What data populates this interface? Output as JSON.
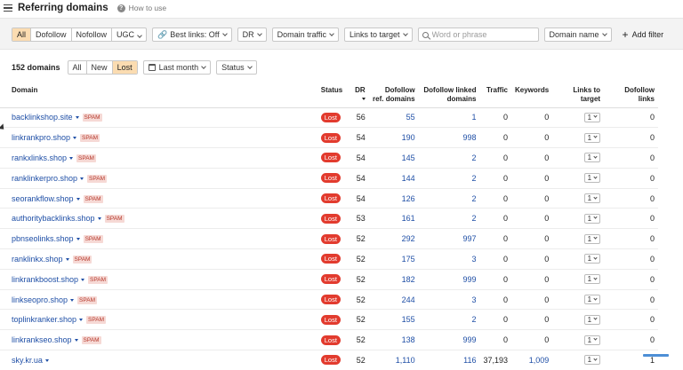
{
  "header": {
    "title": "Referring domains",
    "howto": "How to use"
  },
  "filters": {
    "link_types": [
      "All",
      "Dofollow",
      "Nofollow",
      "UGC"
    ],
    "best_links": "Best links: Off",
    "dr": "DR",
    "domain_traffic": "Domain traffic",
    "links_to_target": "Links to target",
    "search_placeholder": "Word or phrase",
    "search_scope": "Domain name",
    "add_filter": "Add filter"
  },
  "summary": {
    "count": "152 domains",
    "status_tabs": [
      "All",
      "New",
      "Lost"
    ],
    "active_status_tab": "Lost",
    "period": "Last month",
    "status": "Status"
  },
  "table": {
    "headers": {
      "domain": "Domain",
      "status": "Status",
      "dr": "DR",
      "dofollow_ref": "Dofollow ref. domains",
      "dofollow_linked": "Dofollow linked domains",
      "traffic": "Traffic",
      "keywords": "Keywords",
      "links_to_target": "Links to target",
      "dofollow_links": "Dofollow links"
    },
    "rows": [
      {
        "domain": "backlinkshop.site",
        "spam": "SPAM",
        "status": "Lost",
        "dr": "56",
        "ref": "55",
        "linked": "1",
        "traffic": "0",
        "keywords": "0",
        "links": "1",
        "dofollow": "0"
      },
      {
        "domain": "linkrankpro.shop",
        "spam": "SPAM",
        "status": "Lost",
        "dr": "54",
        "ref": "190",
        "linked": "998",
        "traffic": "0",
        "keywords": "0",
        "links": "1",
        "dofollow": "0"
      },
      {
        "domain": "rankxlinks.shop",
        "spam": "SPAM",
        "status": "Lost",
        "dr": "54",
        "ref": "145",
        "linked": "2",
        "traffic": "0",
        "keywords": "0",
        "links": "1",
        "dofollow": "0"
      },
      {
        "domain": "ranklinkerpro.shop",
        "spam": "SPAM",
        "status": "Lost",
        "dr": "54",
        "ref": "144",
        "linked": "2",
        "traffic": "0",
        "keywords": "0",
        "links": "1",
        "dofollow": "0"
      },
      {
        "domain": "seorankflow.shop",
        "spam": "SPAM",
        "status": "Lost",
        "dr": "54",
        "ref": "126",
        "linked": "2",
        "traffic": "0",
        "keywords": "0",
        "links": "1",
        "dofollow": "0"
      },
      {
        "domain": "authoritybacklinks.shop",
        "spam": "SPAM",
        "status": "Lost",
        "dr": "53",
        "ref": "161",
        "linked": "2",
        "traffic": "0",
        "keywords": "0",
        "links": "1",
        "dofollow": "0"
      },
      {
        "domain": "pbnseolinks.shop",
        "spam": "SPAM",
        "status": "Lost",
        "dr": "52",
        "ref": "292",
        "linked": "997",
        "traffic": "0",
        "keywords": "0",
        "links": "1",
        "dofollow": "0"
      },
      {
        "domain": "ranklinkx.shop",
        "spam": "SPAM",
        "status": "Lost",
        "dr": "52",
        "ref": "175",
        "linked": "3",
        "traffic": "0",
        "keywords": "0",
        "links": "1",
        "dofollow": "0"
      },
      {
        "domain": "linkrankboost.shop",
        "spam": "SPAM",
        "status": "Lost",
        "dr": "52",
        "ref": "182",
        "linked": "999",
        "traffic": "0",
        "keywords": "0",
        "links": "1",
        "dofollow": "0"
      },
      {
        "domain": "linkseopro.shop",
        "spam": "SPAM",
        "status": "Lost",
        "dr": "52",
        "ref": "244",
        "linked": "3",
        "traffic": "0",
        "keywords": "0",
        "links": "1",
        "dofollow": "0"
      },
      {
        "domain": "toplinkranker.shop",
        "spam": "SPAM",
        "status": "Lost",
        "dr": "52",
        "ref": "155",
        "linked": "2",
        "traffic": "0",
        "keywords": "0",
        "links": "1",
        "dofollow": "0"
      },
      {
        "domain": "linkrankseo.shop",
        "spam": "SPAM",
        "status": "Lost",
        "dr": "52",
        "ref": "138",
        "linked": "999",
        "traffic": "0",
        "keywords": "0",
        "links": "1",
        "dofollow": "0"
      },
      {
        "domain": "sky.kr.ua",
        "spam": "",
        "status": "Lost",
        "dr": "52",
        "ref": "1,110",
        "linked": "116",
        "traffic": "37,193",
        "keywords": "1,009",
        "links": "1",
        "dofollow": "1"
      }
    ]
  },
  "colors": {
    "accent": "#fbdcb1",
    "link": "#1f4fa6",
    "lost": "#e23b2e",
    "spam_bg": "#f6d9d5"
  }
}
